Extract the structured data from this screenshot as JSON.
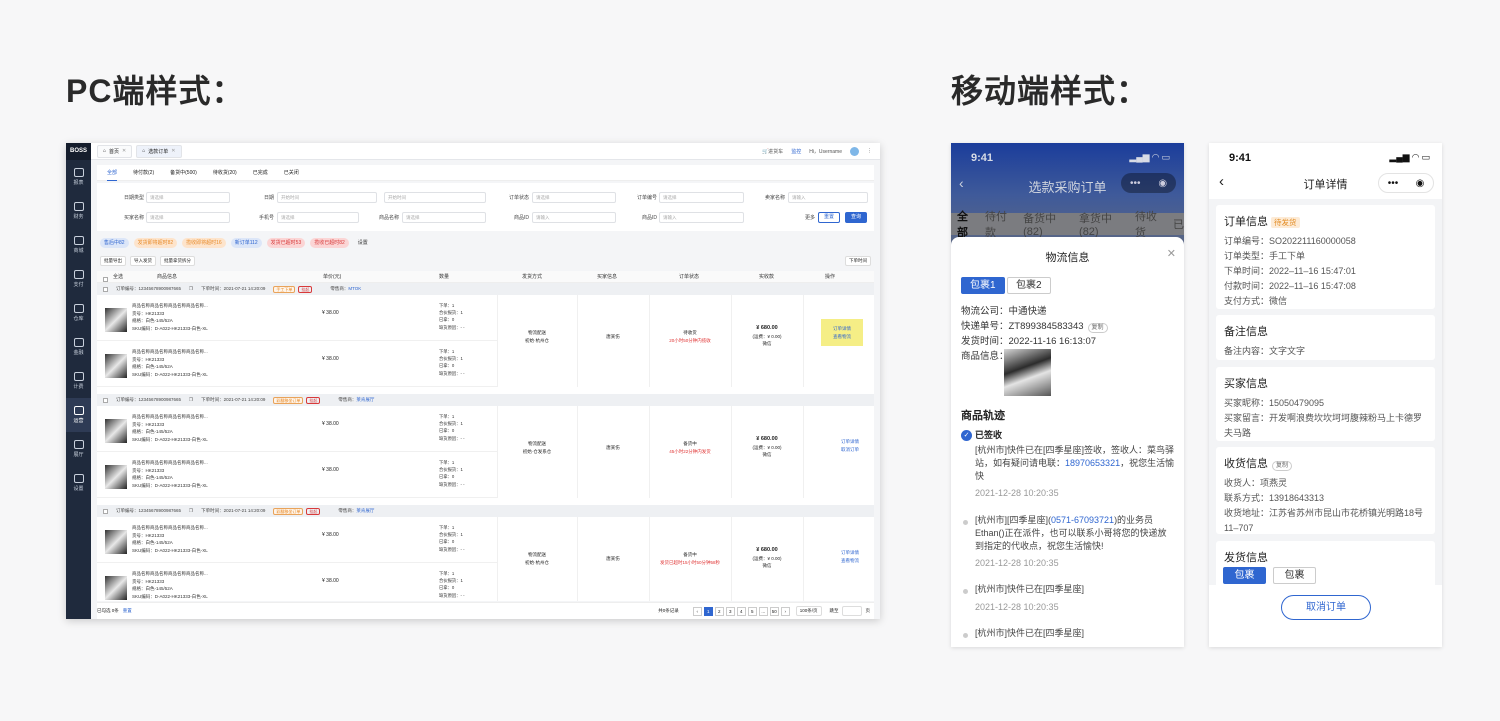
{
  "headings": {
    "pc": "PC端样式：",
    "mobile": "移动端样式："
  },
  "pc": {
    "logo": "BOSS",
    "side": [
      "报表",
      "财务",
      "商城",
      "支付",
      "仓库",
      "金融",
      "计费",
      "运营",
      "展厅",
      "设置"
    ],
    "tabs": [
      {
        "label": "首页"
      },
      {
        "label": "选款订单"
      }
    ],
    "top_right": {
      "cart": "进货车",
      "monitor": "监控",
      "user": "Hi，Username"
    },
    "status_tabs": [
      "全部",
      "待付款(2)",
      "备货中(500)",
      "待收货(20)",
      "已完成",
      "已关闭"
    ],
    "filters": {
      "date_type": "日期类型",
      "date_type_ph": "请选择",
      "date": "日期",
      "start": "开始时间",
      "end": "开始时间",
      "order_status": "订单状态",
      "order_status_ph": "请选择",
      "order_no": "订单编号",
      "order_no_ph": "请选择",
      "buyer": "卖家名称",
      "buyer_ph": "请输入",
      "buyer_name": "买家名称",
      "buyer_name_ph": "请选择",
      "phone": "手机号",
      "phone_ph": "请选择",
      "product_name": "商品名称",
      "product_name_ph": "请选择",
      "product_id": "商品ID",
      "product_id_ph": "请输入",
      "product_id2": "商品ID",
      "product_id2_ph": "请输入",
      "more": "更多",
      "reset": "重置",
      "query": "查询"
    },
    "quick_tags": [
      {
        "label": "售后中82",
        "bg": "#dce6f8",
        "fg": "#2f66d0"
      },
      {
        "label": "发货即将超时82",
        "bg": "#fde4cc",
        "fg": "#e88b2a"
      },
      {
        "label": "揽收即将超时16",
        "bg": "#fde4cc",
        "fg": "#e88b2a"
      },
      {
        "label": "新订单112",
        "bg": "#dce6f8",
        "fg": "#2f66d0"
      },
      {
        "label": "发货已超时53",
        "bg": "#fbd5d5",
        "fg": "#d83a3a"
      },
      {
        "label": "揽收已超时82",
        "bg": "#fbd5d5",
        "fg": "#d83a3a"
      },
      {
        "label": "设置",
        "bg": "transparent",
        "fg": "#333"
      }
    ],
    "toolbar": {
      "export": "批量导出",
      "import": "导入发货",
      "batch": "批量拿货拆分",
      "sort": "下单时间"
    },
    "columns": [
      "全选",
      "商品信息",
      "单价(元)",
      "数量",
      "发货方式",
      "买家信息",
      "订单状态",
      "实收款",
      "操作"
    ],
    "groups": [
      {
        "order_no": "订单编号：12345678900987665",
        "time": "下单时间：2021-07-21 14:20:09",
        "tag1": "手工下单",
        "tag2": "挂起",
        "seller_label": "零售商：",
        "seller": "MTOK",
        "ship": "物流配送",
        "wh": "初始·杭州仓",
        "buyer": "唐某伤",
        "status": "待收货",
        "status2": "20小时50分钟内揽收",
        "pay": "¥ 680.00",
        "pay2": "(运费：¥ 0.00)",
        "pay3": "微信",
        "op1": "订单详情",
        "op2": "查看物流"
      },
      {
        "order_no": "订单编号：12345678900987665",
        "time": "下单时间：2021-07-21 14:20:09",
        "tag1": "彩翻移坐订单",
        "tag2": "挂起",
        "seller_label": "零售商：",
        "seller": "莱肯展厅",
        "ship": "物流配送",
        "wh": "初始·仓发系仓",
        "buyer": "唐某伤",
        "status": "备货中",
        "status2": "45小时22分钟内发货",
        "pay": "¥ 680.00",
        "pay2": "(运费：¥ 0.00)",
        "pay3": "微信",
        "op1": "订单详情",
        "op2": "取消订单"
      },
      {
        "order_no": "订单编号：12345678900987665",
        "time": "下单时间：2021-07-21 14:20:09",
        "tag1": "彩翻移坐订单",
        "tag2": "挂起",
        "seller_label": "零售商：",
        "seller": "莱肯展厅",
        "ship": "物流配送",
        "wh": "初始·杭州仓",
        "buyer": "唐某伤",
        "status": "备货中",
        "status2": "发货已超时15小时50分钟58秒",
        "pay": "¥ 680.00",
        "pay2": "(运费：¥ 0.00)",
        "pay3": "微信",
        "op1": "订单详情",
        "op2": "查看物流"
      }
    ],
    "product": {
      "name": "商品名称商品名称商品名称商品名称...",
      "code": "货号：HK21333",
      "spec": "规格：白色-145/52A",
      "sku": "SKU编码：D-A022-HK21333-白色-XL",
      "price": "¥ 38.00",
      "q1": "下单：1",
      "q2": "合伙报货：1",
      "q3": "已拿：0",
      "q4": "缺货原因：- -"
    },
    "footer": {
      "selected": "已勾选 0条",
      "clear": "重置",
      "total": "共0条记录",
      "pages": [
        "1",
        "2",
        "3",
        "4",
        "5",
        "...",
        "50"
      ],
      "per_page": "100条/页",
      "jump": "跳至",
      "page_unit": "页"
    }
  },
  "m1": {
    "time": "9:41",
    "title": "选款采购订单",
    "tabs": [
      "全部",
      "待付款",
      "备货中(82)",
      "拿货中(82)",
      "待收货",
      "已"
    ],
    "sheet_title": "物流信息",
    "pkg1": "包裹1",
    "pkg2": "包裹2",
    "company": "物流公司：中通快递",
    "tracking": "快递单号：ZT899384583343",
    "copy": "复制",
    "ship_time": "发货时间：2022-11-16 16:13:07",
    "goods": "商品信息：",
    "track_title": "商品轨迹",
    "signed": "已签收",
    "t1": "[杭州市]快件已在[四季星座]签收，签收人：菜鸟驿站，如有疑问请电联：",
    "t1_phone": "18970653321",
    "t1_end": "，祝您生活愉快",
    "t1_time": "2021-12-28 10:20:35",
    "t2a": "[杭州市][四季星座](",
    "t2_phone": "0571-67093721",
    "t2b": ")的业务员Ethan()正在派件，也可以联系小哥将您的快递放到指定的代收点，祝您生活愉快!",
    "t2_time": "2021-12-28 10:20:35",
    "t3": "[杭州市]快件已在[四季星座]",
    "t3_time": "2021-12-28 10:20:35",
    "t4": "[杭州市]快件已在[四季星座]"
  },
  "m2": {
    "time": "9:41",
    "title": "订单详情",
    "order_title": "订单信息",
    "order_badge": "待发货",
    "order_lines": [
      "订单编号：SO202211160000058",
      "订单类型：手工下单",
      "下单时间：2022–11–16 15:47:01",
      "付款时间：2022–11–16 15:47:08",
      "支付方式：微信"
    ],
    "remark_title": "备注信息",
    "remark": "备注内容：文字文字",
    "buyer_title": "买家信息",
    "buyer_lines": [
      "买家昵称：15050479095",
      "买家留言：开发啊浪费坎坎坷坷腹辣粉马上卡德罗夫马路"
    ],
    "recv_title": "收货信息",
    "copy": "复制",
    "recv_lines": [
      "收货人：项燕灵",
      "联系方式：13918643313",
      "收货地址：江苏省苏州市昆山市花桥镇光明路18号11–707"
    ],
    "ship_title": "发货信息",
    "pkg1": "包裹1",
    "pkg2": "包裹2",
    "cancel": "取消订单"
  }
}
